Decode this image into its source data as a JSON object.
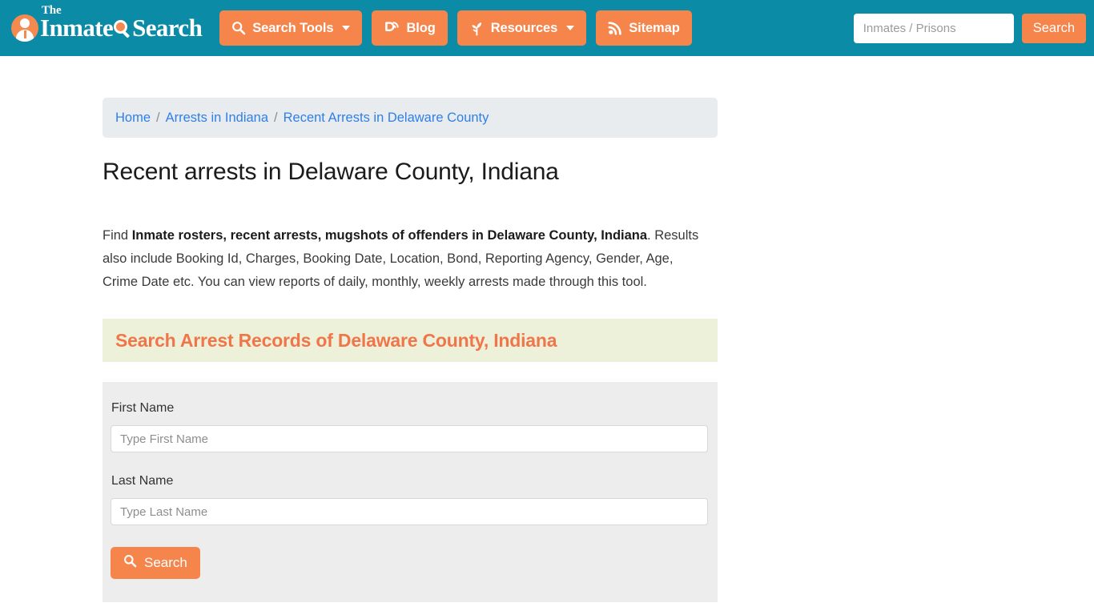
{
  "header": {
    "logo": {
      "small_word": "The",
      "word_one": "Inmate",
      "word_two": "Search",
      "person_icon": "person-badge-icon",
      "glass_icon": "magnifier-icon"
    },
    "nav": [
      {
        "label": "Search Tools",
        "icon": "magnifier-icon",
        "has_caret": true
      },
      {
        "label": "Blog",
        "icon": "blogger-b-icon",
        "has_caret": false
      },
      {
        "label": "Resources",
        "icon": "leaf-icon",
        "has_caret": true
      },
      {
        "label": "Sitemap",
        "icon": "rss-feed-icon",
        "has_caret": false
      }
    ],
    "search": {
      "placeholder": "Inmates / Prisons",
      "value": "",
      "button_label": "Search"
    },
    "colors": {
      "bar": "#0b8ba6",
      "accent": "#f5854b"
    }
  },
  "breadcrumb": {
    "items": [
      {
        "label": "Home"
      },
      {
        "label": "Arrests in Indiana"
      },
      {
        "label": "Recent Arrests in Delaware County"
      }
    ],
    "separator": "/"
  },
  "main": {
    "page_title": "Recent arrests in Delaware County, Indiana",
    "intro": {
      "lead": "Find ",
      "bold": "Inmate rosters, recent arrests, mugshots of offenders in Delaware County, Indiana",
      "rest": ". Results also include Booking Id, Charges, Booking Date, Location, Bond, Reporting Agency, Gender, Age, Crime Date etc. You can view reports of daily, monthly, weekly arrests made through this tool."
    },
    "section_banner": {
      "title": "Search Arrest Records of Delaware County, Indiana",
      "background": "#eef1da",
      "text_color": "#f0764a"
    },
    "form": {
      "first_name": {
        "label": "First Name",
        "placeholder": "Type First Name",
        "value": ""
      },
      "last_name": {
        "label": "Last Name",
        "placeholder": "Type Last Name",
        "value": ""
      },
      "submit": {
        "label": "Search",
        "icon": "magnifier-icon"
      }
    }
  }
}
